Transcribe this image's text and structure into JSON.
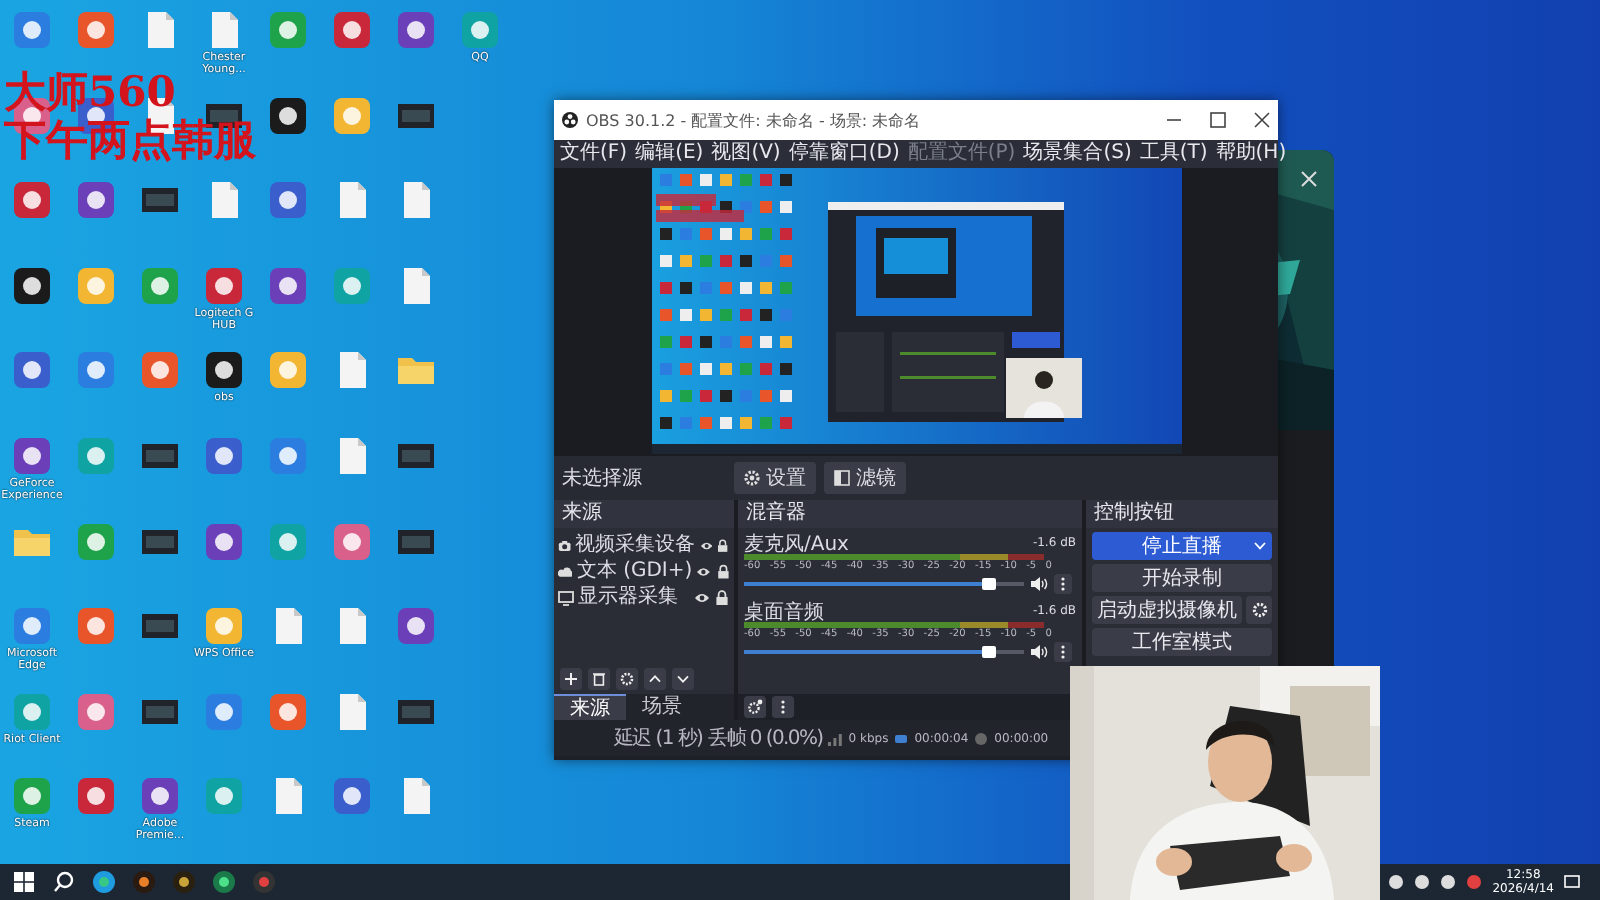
{
  "desktop": {
    "overlay_text": [
      "大师560",
      "下午两点韩服"
    ],
    "icon_rows": [
      [
        {
          "kind": "app"
        },
        {
          "kind": "app"
        },
        {
          "kind": "file"
        },
        {
          "kind": "file",
          "label": "Chester Young..."
        },
        {
          "kind": "app"
        },
        {
          "kind": "app"
        },
        {
          "kind": "app"
        },
        {
          "kind": "app",
          "label": "QQ"
        }
      ],
      [
        {
          "kind": "app"
        },
        {
          "kind": "app"
        },
        {
          "kind": "file"
        },
        {
          "kind": "video"
        },
        {
          "kind": "app"
        },
        {
          "kind": "app"
        },
        {
          "kind": "video"
        }
      ],
      [
        {
          "kind": "app"
        },
        {
          "kind": "app"
        },
        {
          "kind": "video"
        },
        {
          "kind": "file"
        },
        {
          "kind": "app"
        },
        {
          "kind": "file"
        },
        {
          "kind": "file"
        }
      ],
      [
        {
          "kind": "app"
        },
        {
          "kind": "app"
        },
        {
          "kind": "app"
        },
        {
          "kind": "app",
          "label": "Logitech G HUB"
        },
        {
          "kind": "app"
        },
        {
          "kind": "app"
        },
        {
          "kind": "file"
        }
      ],
      [
        {
          "kind": "app"
        },
        {
          "kind": "app"
        },
        {
          "kind": "app"
        },
        {
          "kind": "app",
          "label": "obs"
        },
        {
          "kind": "app"
        },
        {
          "kind": "file"
        },
        {
          "kind": "folder"
        }
      ],
      [
        {
          "kind": "app",
          "label": "GeForce Experience"
        },
        {
          "kind": "app"
        },
        {
          "kind": "video"
        },
        {
          "kind": "app"
        },
        {
          "kind": "app"
        },
        {
          "kind": "file"
        },
        {
          "kind": "video"
        }
      ],
      [
        {
          "kind": "folder"
        },
        {
          "kind": "app"
        },
        {
          "kind": "video"
        },
        {
          "kind": "app"
        },
        {
          "kind": "app"
        },
        {
          "kind": "app"
        },
        {
          "kind": "video"
        }
      ],
      [
        {
          "kind": "app",
          "label": "Microsoft Edge"
        },
        {
          "kind": "app"
        },
        {
          "kind": "video"
        },
        {
          "kind": "app",
          "label": "WPS Office"
        },
        {
          "kind": "file"
        },
        {
          "kind": "file"
        },
        {
          "kind": "app"
        }
      ],
      [
        {
          "kind": "app",
          "label": "Riot Client"
        },
        {
          "kind": "app"
        },
        {
          "kind": "video"
        },
        {
          "kind": "app"
        },
        {
          "kind": "app"
        },
        {
          "kind": "file"
        },
        {
          "kind": "video"
        }
      ],
      [
        {
          "kind": "app",
          "label": "Steam"
        },
        {
          "kind": "app"
        },
        {
          "kind": "app",
          "label": "Adobe Premie..."
        },
        {
          "kind": "app"
        },
        {
          "kind": "file"
        },
        {
          "kind": "app"
        },
        {
          "kind": "file"
        }
      ]
    ]
  },
  "obs_window": {
    "title": "OBS 30.1.2 - 配置文件: 未命名 - 场景: 未命名",
    "menus": [
      {
        "label": "文件(F)",
        "disabled": false
      },
      {
        "label": "编辑(E)",
        "disabled": false
      },
      {
        "label": "视图(V)",
        "disabled": false
      },
      {
        "label": "停靠窗口(D)",
        "disabled": false
      },
      {
        "label": "配置文件(P)",
        "disabled": true
      },
      {
        "label": "场景集合(S)",
        "disabled": false
      },
      {
        "label": "工具(T)",
        "disabled": false
      },
      {
        "label": "帮助(H)",
        "disabled": false
      }
    ],
    "source_bar": {
      "label": "未选择源",
      "buttons": [
        {
          "kind": "settings",
          "label": "设置"
        },
        {
          "kind": "filters",
          "label": "滤镜"
        }
      ]
    },
    "sources": {
      "header": "来源",
      "items": [
        {
          "kind": "camera",
          "label": "视频采集设备",
          "visible": true,
          "locked": true
        },
        {
          "kind": "text",
          "label": "文本 (GDI+)",
          "visible": true,
          "locked": true
        },
        {
          "kind": "monitor",
          "label": "显示器采集",
          "visible": true,
          "locked": true
        }
      ]
    },
    "tabs": [
      {
        "label": "来源",
        "selected": true
      },
      {
        "label": "场景",
        "selected": false
      }
    ],
    "mixer": {
      "header": "混音器",
      "channels": [
        {
          "name": "麦克风/Aux",
          "reading": "-1.6 dB",
          "scale": [
            "-60",
            "-55",
            "-50",
            "-45",
            "-40",
            "-35",
            "-30",
            "-25",
            "-20",
            "-15",
            "-10",
            "-5",
            "0"
          ],
          "level": 0.88,
          "muted": false
        },
        {
          "name": "桌面音频",
          "reading": "-1.6 dB",
          "scale": [
            "-60",
            "-55",
            "-50",
            "-45",
            "-40",
            "-35",
            "-30",
            "-25",
            "-20",
            "-15",
            "-10",
            "-5",
            "0"
          ],
          "level": 0.88,
          "muted": false
        }
      ]
    },
    "controls": {
      "header": "控制按钮",
      "buttons": [
        {
          "kind": "primary",
          "label": "停止直播"
        },
        {
          "kind": "plain",
          "label": "开始录制"
        },
        {
          "kind": "with-settings",
          "label": "启动虚拟摄像机"
        },
        {
          "kind": "plain",
          "label": "工作室模式"
        }
      ]
    },
    "status_bar": {
      "delay": "延迟 (1 秒)",
      "dropped": "丢帧 0 (0.0%)",
      "bitrate": "0 kbps",
      "stream_time": "00:00:04",
      "record_time": "00:00:00"
    }
  },
  "taskbar": {
    "time": "12:58",
    "date": "2026/4/14"
  }
}
